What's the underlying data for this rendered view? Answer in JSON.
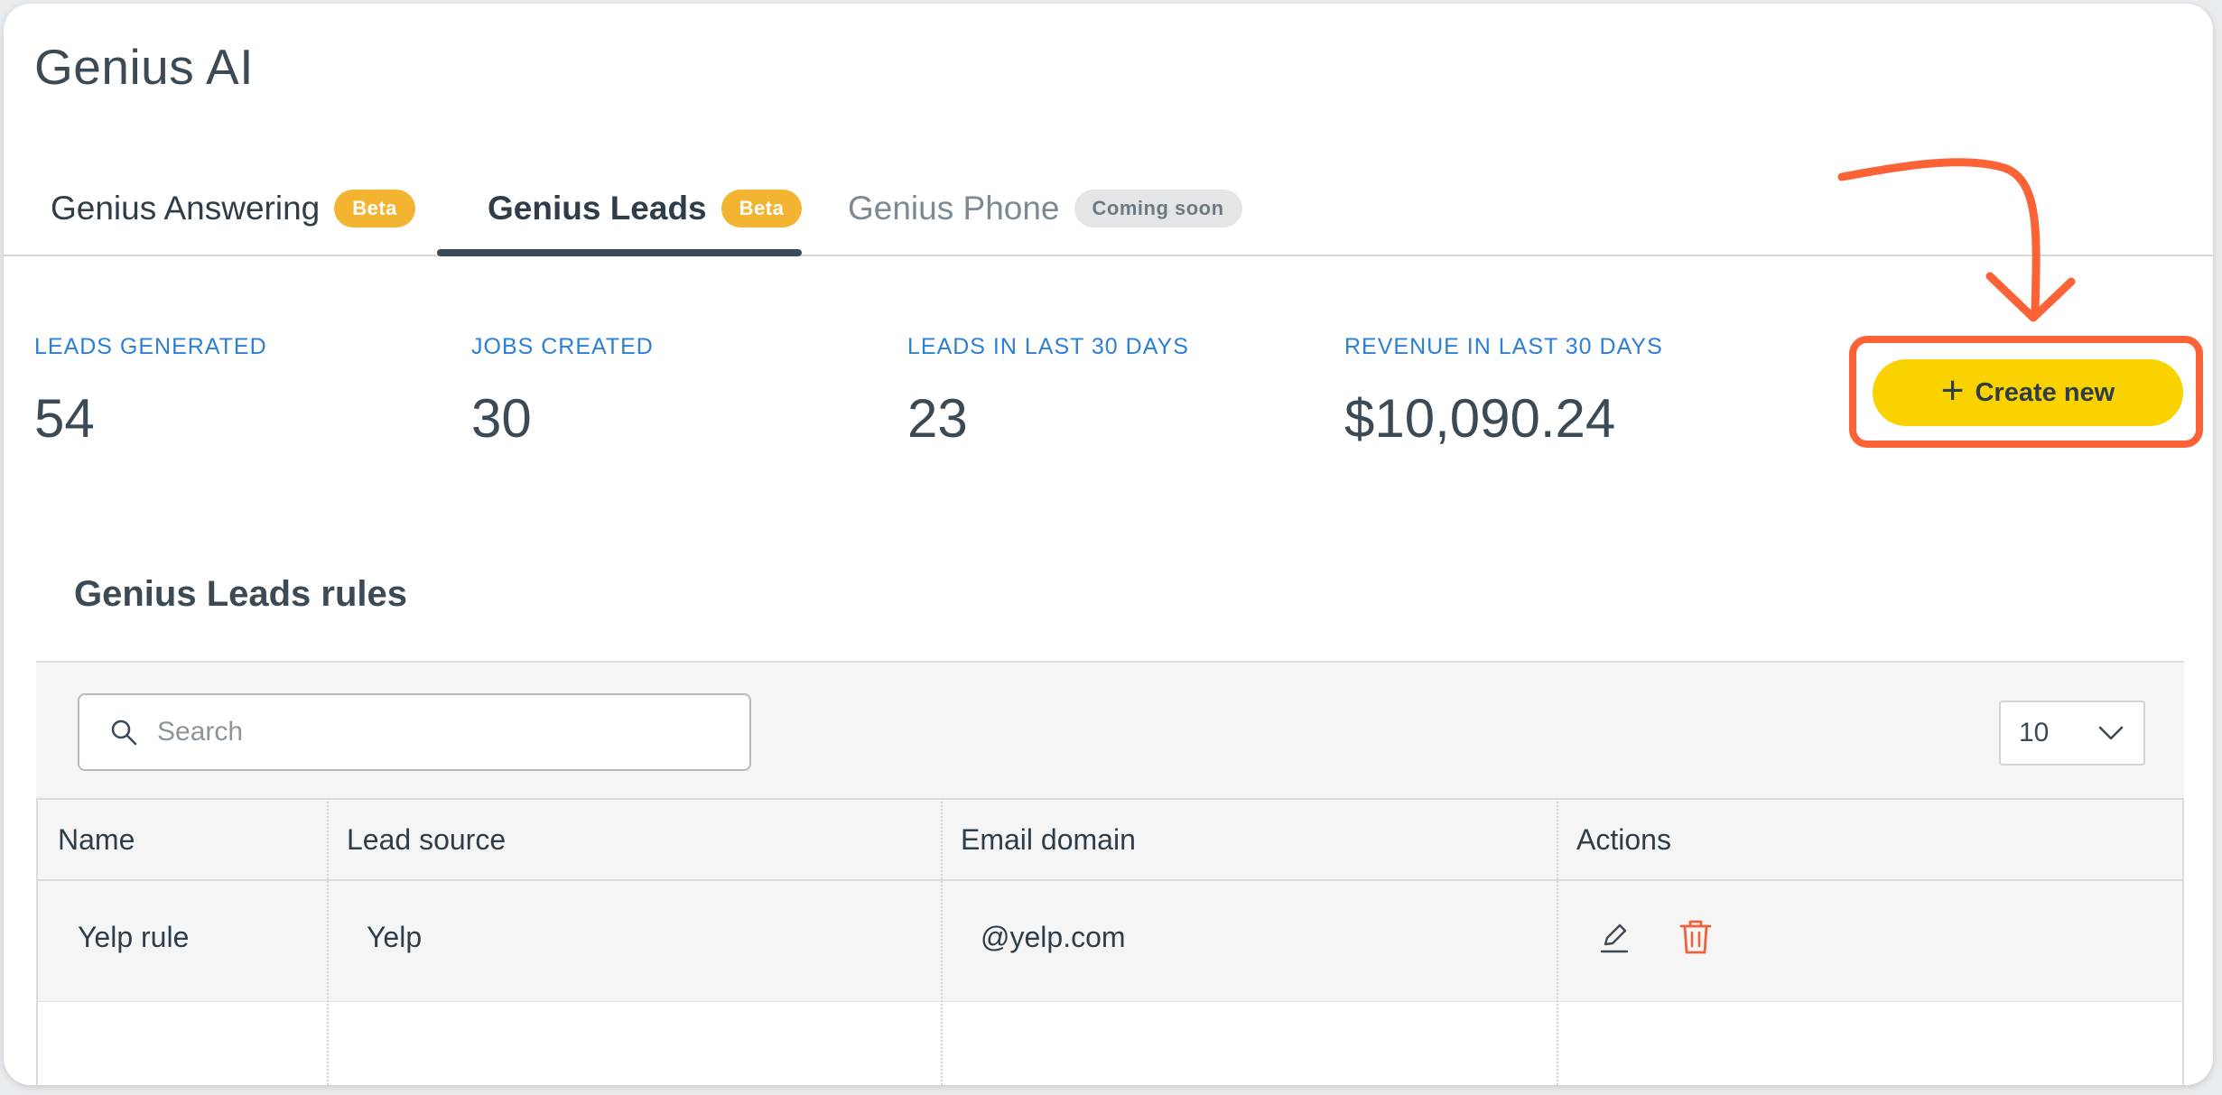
{
  "page": {
    "title": "Genius AI"
  },
  "tabs": [
    {
      "label": "Genius Answering",
      "badge": "Beta",
      "state": "default"
    },
    {
      "label": "Genius Leads",
      "badge": "Beta",
      "state": "active"
    },
    {
      "label": "Genius Phone",
      "badge": "Coming soon",
      "state": "disabled"
    }
  ],
  "stats": [
    {
      "label": "LEADS GENERATED",
      "value": "54"
    },
    {
      "label": "JOBS CREATED",
      "value": "30"
    },
    {
      "label": "LEADS IN LAST 30 DAYS",
      "value": "23"
    },
    {
      "label": "REVENUE IN LAST 30 DAYS",
      "value": "$10,090.24"
    }
  ],
  "create_button": {
    "label": "Create new",
    "icon": "plus-icon"
  },
  "rules": {
    "title": "Genius Leads rules",
    "search_placeholder": "Search",
    "per_page": "10",
    "columns": [
      "Name",
      "Lead source",
      "Email domain",
      "Actions"
    ],
    "rows": [
      {
        "name": "Yelp rule",
        "lead_source": "Yelp",
        "email_domain": "@yelp.com"
      }
    ]
  },
  "colors": {
    "accent_yellow": "#f9d200",
    "annotation_orange": "#fb6236",
    "badge_beta": "#f2b431",
    "stat_label_blue": "#2b7fd6",
    "delete_red": "#f0623c"
  }
}
